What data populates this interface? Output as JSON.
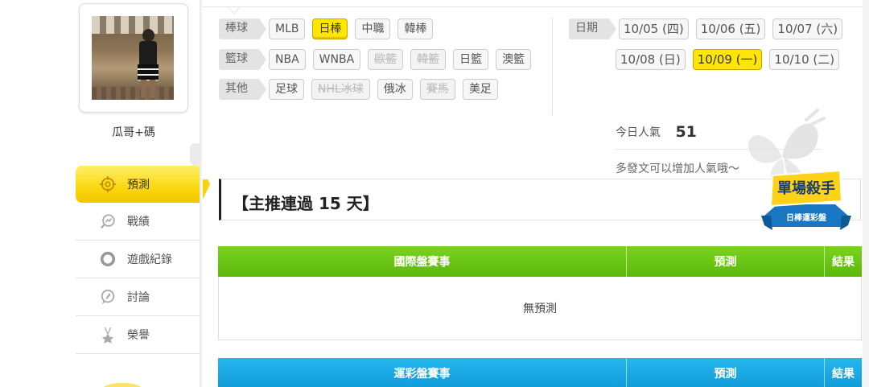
{
  "profile": {
    "username": "瓜哥+碼"
  },
  "menu": [
    {
      "label": "預測",
      "icon": "target-icon",
      "active": true
    },
    {
      "label": "戰績",
      "icon": "chart-search-icon",
      "active": false
    },
    {
      "label": "遊戲紀錄",
      "icon": "circle-icon",
      "active": false
    },
    {
      "label": "討論",
      "icon": "discussion-icon",
      "active": false
    },
    {
      "label": "榮譽",
      "icon": "medal-icon",
      "active": false
    }
  ],
  "filters": {
    "baseball": {
      "label": "棒球",
      "items": [
        "MLB",
        "日棒",
        "中職",
        "韓棒"
      ],
      "selected": "日棒",
      "disabled": []
    },
    "basketball": {
      "label": "籃球",
      "items": [
        "NBA",
        "WNBA",
        "歐籃",
        "韓籃",
        "日籃",
        "澳籃"
      ],
      "disabled": [
        "歐籃",
        "韓籃"
      ]
    },
    "other": {
      "label": "其他",
      "items": [
        "足球",
        "NHL冰球",
        "俄冰",
        "賽馬",
        "美足"
      ],
      "disabled": [
        "NHL冰球",
        "賽馬"
      ]
    }
  },
  "dates": {
    "label": "日期",
    "row1": [
      "10/05 (四)",
      "10/06 (五)",
      "10/07 (六)"
    ],
    "row2": [
      "10/08 (日)",
      "10/09 (一)",
      "10/10 (二)"
    ],
    "selected": "10/09 (一)"
  },
  "popularity": {
    "label": "今日人氣",
    "value": "51",
    "hint": "多發文可以增加人氣哦～"
  },
  "banner": {
    "title": "【主推連過 15 天】"
  },
  "badge": {
    "title": "單場殺手",
    "subtitle": "日棒運彩盤"
  },
  "tables": [
    {
      "headers": [
        "國際盤賽事",
        "預測",
        "結果"
      ],
      "empty": "無預測",
      "color": "#6cc716"
    },
    {
      "headers": [
        "運彩盤賽事",
        "預測",
        "結果"
      ],
      "empty": "",
      "color": "#1aa8e4"
    }
  ]
}
